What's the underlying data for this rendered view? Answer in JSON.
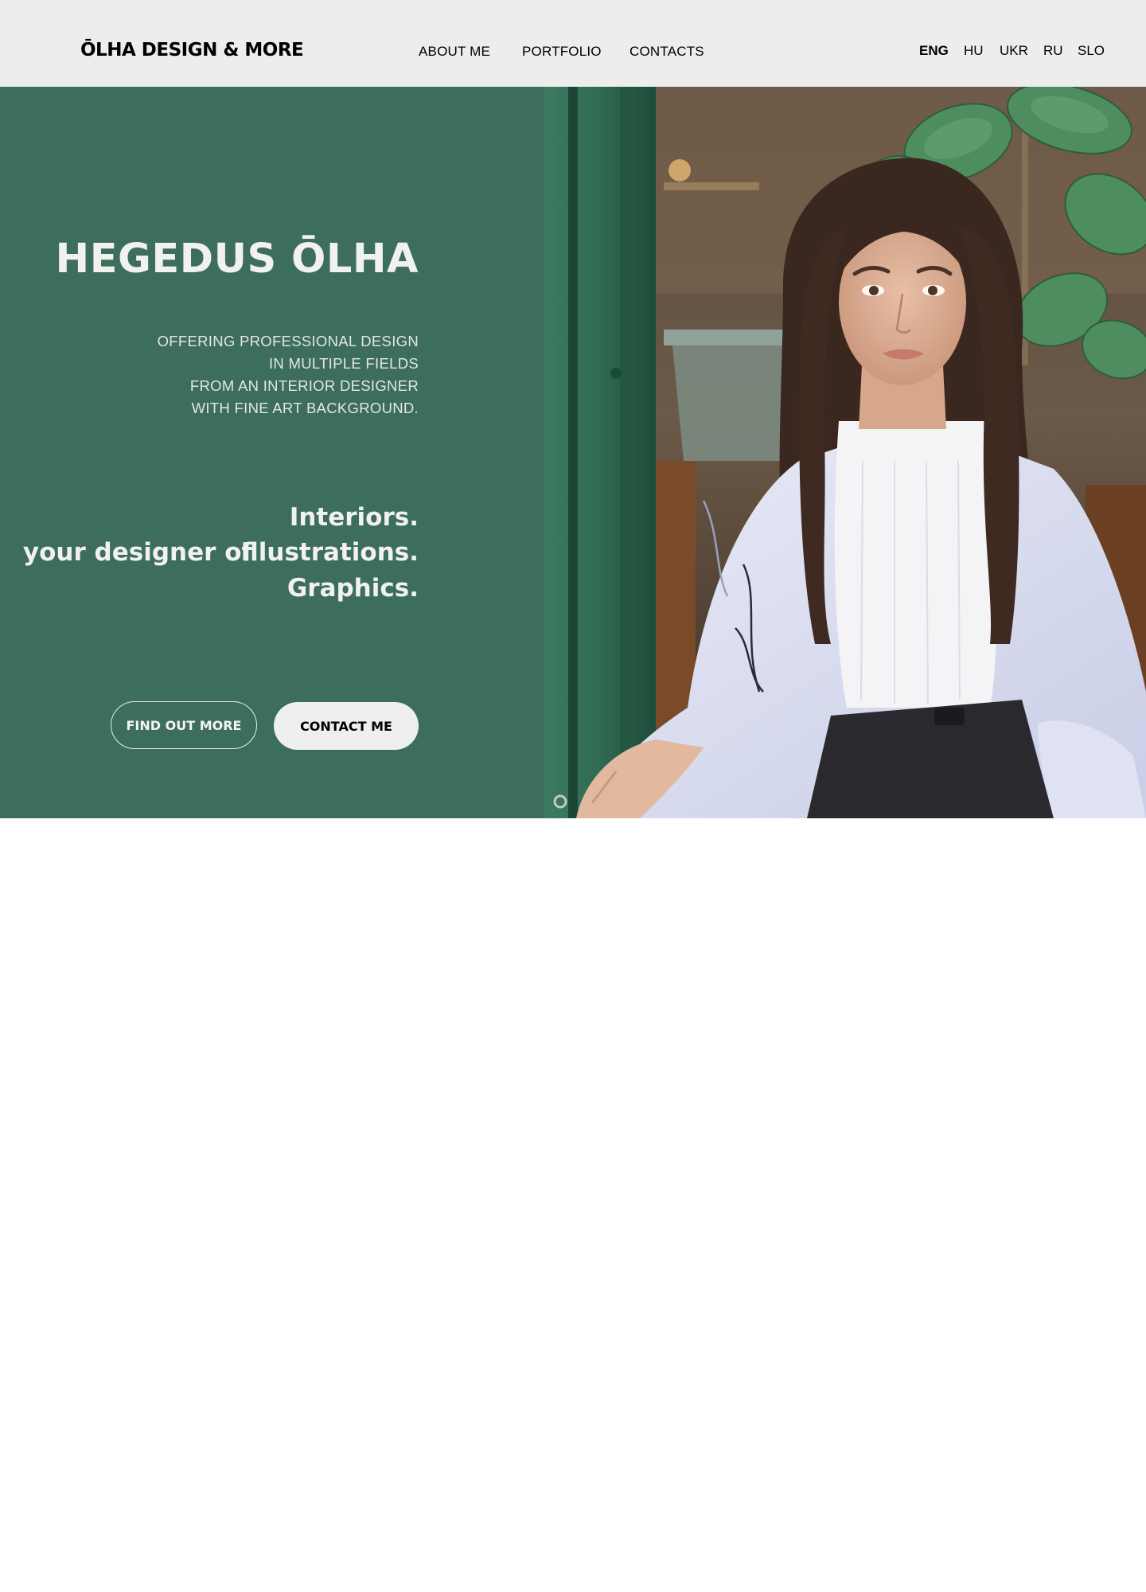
{
  "header": {
    "logo": "ŌLHA DESIGN & MORE",
    "nav": [
      "ABOUT ME",
      "PORTFOLIO",
      "CONTACTS"
    ],
    "languages": [
      "ENG",
      "HU",
      "UKR",
      "RU",
      "SLO"
    ],
    "active_language": "ENG"
  },
  "hero": {
    "title": "HEGEDUS ŌLHA",
    "tagline": [
      "OFFERING PROFESSIONAL DESIGN",
      "IN MULTIPLE FIELDS",
      "FROM AN INTERIOR DESIGNER",
      "WITH FINE ART BACKGROUND."
    ],
    "designer_prefix": "your designer of",
    "fields": [
      "Interiors.",
      "Illustrations.",
      "Graphics."
    ],
    "buttons": {
      "find_out_more": "FIND OUT MORE",
      "contact_me": "CONTACT ME"
    }
  },
  "colors": {
    "header_bg": "#ededed",
    "hero_green": "#3c6d5f",
    "hero_text": "#f1f1ee",
    "contact_button_bg": "#efefef"
  }
}
